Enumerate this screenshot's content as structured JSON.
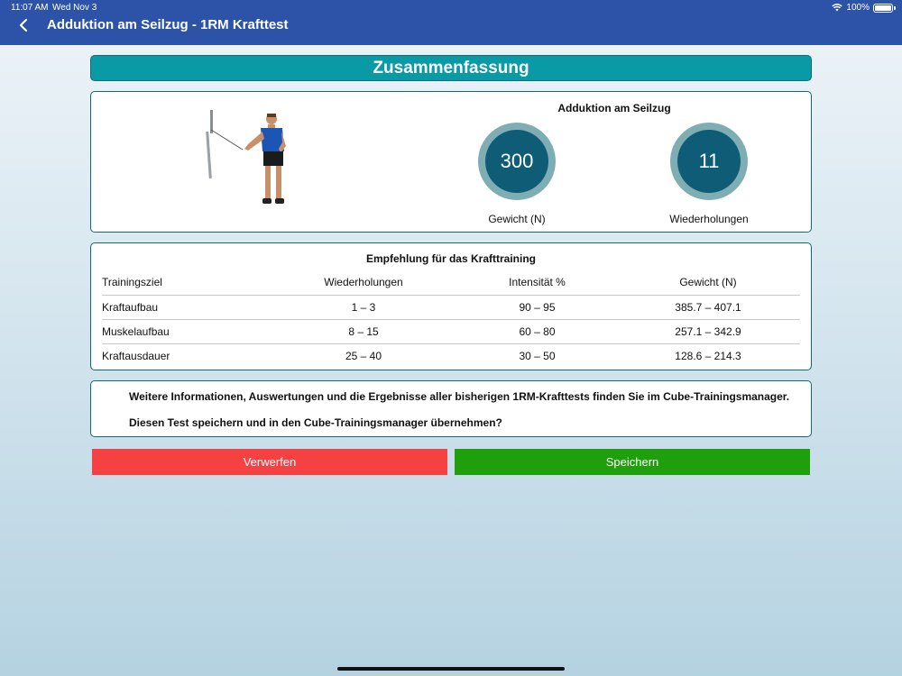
{
  "status_bar": {
    "time": "11:07 AM",
    "date": "Wed Nov 3",
    "battery": "100%"
  },
  "nav": {
    "title": "Adduktion am Seilzug - 1RM Krafttest"
  },
  "summary": {
    "header": "Zusammenfassung",
    "exercise_title": "Adduktion am Seilzug",
    "weight": {
      "value": "300",
      "label": "Gewicht (N)"
    },
    "reps": {
      "value": "11",
      "label": "Wiederholungen"
    }
  },
  "recommendation": {
    "title": "Empfehlung für das Krafttraining",
    "columns": [
      "Trainingsziel",
      "Wiederholungen",
      "Intensität %",
      "Gewicht (N)"
    ],
    "rows": [
      [
        "Kraftaufbau",
        "1 – 3",
        "90 – 95",
        "385.7 – 407.1"
      ],
      [
        "Muskelaufbau",
        "8 – 15",
        "60 – 80",
        "257.1 – 342.9"
      ],
      [
        "Kraftausdauer",
        "25 – 40",
        "30 – 50",
        "128.6 – 214.3"
      ]
    ]
  },
  "info": {
    "line1": "Weitere Informationen, Auswertungen und die Ergebnisse aller bisherigen 1RM-Krafttests finden Sie im Cube-Trainingsmanager.",
    "line2": "Diesen Test speichern und in den Cube-Trainingsmanager übernehmen?"
  },
  "actions": {
    "discard": "Verwerfen",
    "save": "Speichern"
  },
  "colors": {
    "nav": "#2c53a8",
    "header": "#0a9aa5",
    "ring_outer": "#7eaeb3",
    "ring_inner": "#0f5c76",
    "discard": "#f54141",
    "save": "#1f9f0c"
  },
  "icons": {
    "back": "chevron-left-icon",
    "wifi": "wifi-icon",
    "battery": "battery-icon"
  }
}
